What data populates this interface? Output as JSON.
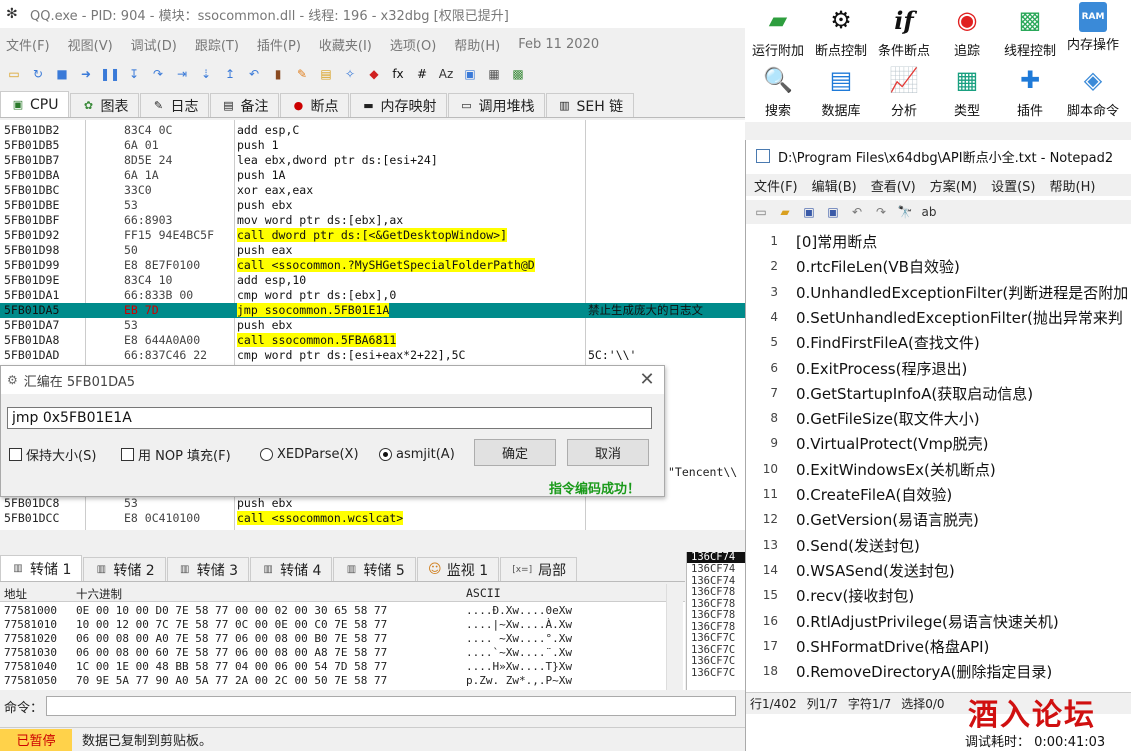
{
  "debugger": {
    "title": "QQ.exe - PID: 904 - 模块：ssocommon.dll - 线程: 196 - x32dbg [权限已提升]",
    "menu": [
      "文件(F)",
      "视图(V)",
      "调试(D)",
      "跟踪(T)",
      "插件(P)",
      "收藏夹(I)",
      "选项(O)",
      "帮助(H)",
      "Feb 11 2020"
    ],
    "toolbar_glyphs": [
      "▭",
      "↻",
      "■",
      "➜",
      "❚❚",
      "↧",
      "↷",
      "⇥",
      "⇣",
      "↥",
      "↶",
      "▮",
      "✎",
      "▤",
      "✧",
      "◆",
      "fx",
      "#",
      "Az",
      "▣",
      "▦",
      "▩"
    ],
    "tabs": [
      {
        "label": "CPU",
        "icon": "cpu-icon",
        "glyph": "▣"
      },
      {
        "label": "图表",
        "icon": "graph-icon",
        "glyph": "✿"
      },
      {
        "label": "日志",
        "icon": "log-icon",
        "glyph": "✎"
      },
      {
        "label": "备注",
        "icon": "notes-icon",
        "glyph": "▤"
      },
      {
        "label": "断点",
        "icon": "breakpoint-icon",
        "glyph": "●"
      },
      {
        "label": "内存映射",
        "icon": "memory-map-icon",
        "glyph": "▬"
      },
      {
        "label": "调用堆栈",
        "icon": "call-stack-icon",
        "glyph": "▭"
      },
      {
        "label": "SEH 链",
        "icon": "seh-icon",
        "glyph": "▥"
      }
    ],
    "disasm": [
      {
        "addr": "5FB01DB2",
        "bytes": "83C4 0C",
        "ins": "add esp,C",
        "cmt": ""
      },
      {
        "addr": "5FB01DB5",
        "bytes": "6A 01",
        "ins": "push 1",
        "cmt": ""
      },
      {
        "addr": "5FB01DB7",
        "bytes": "8D5E 24",
        "ins": "lea ebx,dword ptr ds:[esi+24]",
        "cmt": ""
      },
      {
        "addr": "5FB01DBA",
        "bytes": "6A 1A",
        "ins": "push 1A",
        "cmt": ""
      },
      {
        "addr": "5FB01DBC",
        "bytes": "33C0",
        "ins": "xor eax,eax",
        "cmt": ""
      },
      {
        "addr": "5FB01DBE",
        "bytes": "53",
        "ins": "push ebx",
        "cmt": ""
      },
      {
        "addr": "5FB01DBF",
        "bytes": "66:8903",
        "ins": "mov word ptr ds:[ebx],ax",
        "cmt": ""
      },
      {
        "addr": "5FB01D92",
        "bytes": "FF15 94E4BC5F",
        "ins": "call dword ptr ds:[<&GetDesktopWindow>]",
        "cmt": ""
      },
      {
        "addr": "5FB01D98",
        "bytes": "50",
        "ins": "push eax",
        "cmt": ""
      },
      {
        "addr": "5FB01D99",
        "bytes": "E8 8E7F0100",
        "ins": "call <ssocommon.?MySHGetSpecialFolderPath@D",
        "cmt": ""
      },
      {
        "addr": "5FB01D9E",
        "bytes": "83C4 10",
        "ins": "add esp,10",
        "cmt": ""
      },
      {
        "addr": "5FB01DA1",
        "bytes": "66:833B 00",
        "ins": "cmp word ptr ds:[ebx],0",
        "cmt": ""
      },
      {
        "addr": "5FB01DA5",
        "bytes": "EB 7D",
        "ins": "jmp ssocommon.5FB01E1A",
        "cmt": "禁止生成庞大的日志文"
      },
      {
        "addr": "5FB01DA7",
        "bytes": "53",
        "ins": "push ebx",
        "cmt": ""
      },
      {
        "addr": "5FB01DA8",
        "bytes": "E8 644A0A00",
        "ins": "call ssocommon.5FBA6811",
        "cmt": ""
      },
      {
        "addr": "5FB01DAD",
        "bytes": "66:837C46 22",
        "ins": "cmp word ptr ds:[esi+eax*2+22],5C",
        "cmt": "5C:'\\\\'"
      }
    ],
    "disasm_bottom": [
      {
        "addr": "5FB01DC8",
        "bytes": "53",
        "ins": "push ebx",
        "cmt": ""
      },
      {
        "addr": "5FB01DCC",
        "bytes": "E8 0C410100",
        "ins": "call <ssocommon.wcslcat>",
        "cmt": ""
      }
    ],
    "peek_comment": "\"Tencent\\\\",
    "dialog": {
      "title": "汇编在 5FB01DA5",
      "input": "jmp 0x5FB01E1A",
      "keep_size": "保持大小(S)",
      "nop_fill": "用 NOP 填充(F)",
      "xedparse": "XEDParse(X)",
      "asmjit": "asmjit(A)",
      "ok": "确定",
      "cancel": "取消",
      "status": "指令编码成功！"
    },
    "dump_tabs": [
      {
        "label": "转储 1",
        "icon": "dump-icon"
      },
      {
        "label": "转储 2",
        "icon": "dump-icon"
      },
      {
        "label": "转储 3",
        "icon": "dump-icon"
      },
      {
        "label": "转储 4",
        "icon": "dump-icon"
      },
      {
        "label": "转储 5",
        "icon": "dump-icon"
      },
      {
        "label": "监视 1",
        "icon": "watch-icon"
      },
      {
        "label": "局部",
        "icon": "locals-icon"
      }
    ],
    "locals_glyph": "[x=]",
    "dump_header": {
      "addr": "地址",
      "hex": "十六进制",
      "ascii": "ASCII"
    },
    "dump_rows": [
      {
        "addr": "77581000",
        "hex": "0E 00 10 00  D0 7E 58 77  00 00 02 00  30 65 58 77",
        "ascii": "....Ð.Xw....0eXw"
      },
      {
        "addr": "77581010",
        "hex": "10 00 12 00  7C 7E 58 77  0C 00 0E 00  C0 7E 58 77",
        "ascii": "....|~Xw....À.Xw"
      },
      {
        "addr": "77581020",
        "hex": "06 00 08 00  A0 7E 58 77  06 00 08 00  B0 7E 58 77",
        "ascii": ".... ~Xw....°.Xw"
      },
      {
        "addr": "77581030",
        "hex": "06 00 08 00  60 7E 58 77  06 00 08 00  A8 7E 58 77",
        "ascii": "....`~Xw....¨.Xw"
      },
      {
        "addr": "77581040",
        "hex": "1C 00 1E 00  48 BB 58 77  04 00 06 00  54 7D 58 77",
        "ascii": "....H»Xw....T}Xw"
      },
      {
        "addr": "77581050",
        "hex": "70 9E 5A 77  90 A0 5A 77  2A 00 2C 00  50 7E 58 77",
        "ascii": "p.Zw. Zw*.,.P~Xw"
      }
    ],
    "stack_top": "136CF74",
    "stack_rows": [
      "136CF74",
      "136CF74",
      "136CF78",
      "136CF78",
      "136CF78",
      "136CF78",
      "136CF7C",
      "136CF7C",
      "136CF7C",
      "136CF7C"
    ],
    "cmd_label": "命令：",
    "paused": "已暂停",
    "status_msg": "数据已复制到剪贴板。",
    "runtime": "调试耗时： 0:00:41:03"
  },
  "plugin_toolbar": [
    {
      "label": "运行附加",
      "icon": "folder-icon",
      "color": "#2e9e3e",
      "glyph": "▰"
    },
    {
      "label": "断点控制",
      "icon": "gear-icon",
      "color": "#111111",
      "glyph": "⚙"
    },
    {
      "label": "条件断点",
      "icon": "if-icon",
      "color": "#111111",
      "glyph": "if"
    },
    {
      "label": "追踪",
      "icon": "target-icon",
      "color": "#e02020",
      "glyph": "◉"
    },
    {
      "label": "线程控制",
      "icon": "monitor-icon",
      "color": "#2ba85a",
      "glyph": "▩"
    },
    {
      "label": "内存操作",
      "icon": "ram-icon",
      "color": "#3a8ad8",
      "glyph": "RAM"
    },
    {
      "label": "搜索",
      "icon": "search-icon",
      "color": "#f07020",
      "glyph": "🔍"
    },
    {
      "label": "数据库",
      "icon": "database-icon",
      "color": "#1f7ad8",
      "glyph": "▤"
    },
    {
      "label": "分析",
      "icon": "chart-icon",
      "color": "#3a8ad8",
      "glyph": "📈"
    },
    {
      "label": "类型",
      "icon": "grid-icon",
      "color": "#1aa080",
      "glyph": "▦"
    },
    {
      "label": "插件",
      "icon": "puzzle-icon",
      "color": "#1f7ad8",
      "glyph": "✚"
    },
    {
      "label": "脚本命令",
      "icon": "script-icon",
      "color": "#3a8ad8",
      "glyph": "◈"
    }
  ],
  "notepad": {
    "title": "D:\\Program Files\\x64dbg\\API断点小全.txt - Notepad2",
    "menu": [
      "文件(F)",
      "编辑(B)",
      "查看(V)",
      "方案(M)",
      "设置(S)",
      "帮助(H)"
    ],
    "tool_glyphs": [
      "▭",
      "▰",
      "▣",
      "▣",
      "↶",
      "↷",
      "🔭",
      "ab"
    ],
    "lines": [
      {
        "n": "1",
        "text": "[0]常用断点"
      },
      {
        "n": "2",
        "text": "0.rtcFileLen(VB自效验)"
      },
      {
        "n": "3",
        "text": "0.UnhandledExceptionFilter(判断进程是否附加"
      },
      {
        "n": "4",
        "text": "0.SetUnhandledExceptionFilter(抛出异常来判"
      },
      {
        "n": "5",
        "text": "0.FindFirstFileA(查找文件)"
      },
      {
        "n": "6",
        "text": "0.ExitProcess(程序退出)"
      },
      {
        "n": "7",
        "text": "0.GetStartupInfoA(获取启动信息)"
      },
      {
        "n": "8",
        "text": "0.GetFileSize(取文件大小)"
      },
      {
        "n": "9",
        "text": "0.VirtualProtect(Vmp脱壳)"
      },
      {
        "n": "10",
        "text": "0.ExitWindowsEx(关机断点)"
      },
      {
        "n": "11",
        "text": "0.CreateFileA(自效验)"
      },
      {
        "n": "12",
        "text": "0.GetVersion(易语言脱壳)"
      },
      {
        "n": "13",
        "text": "0.Send(发送封包)"
      },
      {
        "n": "14",
        "text": "0.WSASend(发送封包)"
      },
      {
        "n": "15",
        "text": "0.recv(接收封包)"
      },
      {
        "n": "16",
        "text": "0.RtlAdjustPrivilege(易语言快速关机)"
      },
      {
        "n": "17",
        "text": "0.SHFormatDrive(格盘API)"
      },
      {
        "n": "18",
        "text": "0.RemoveDirectoryA(删除指定目录)"
      }
    ],
    "status": [
      "行1/402",
      "列1/7",
      "字符1/7",
      "选择0/0"
    ]
  },
  "watermark": "酒入论坛"
}
